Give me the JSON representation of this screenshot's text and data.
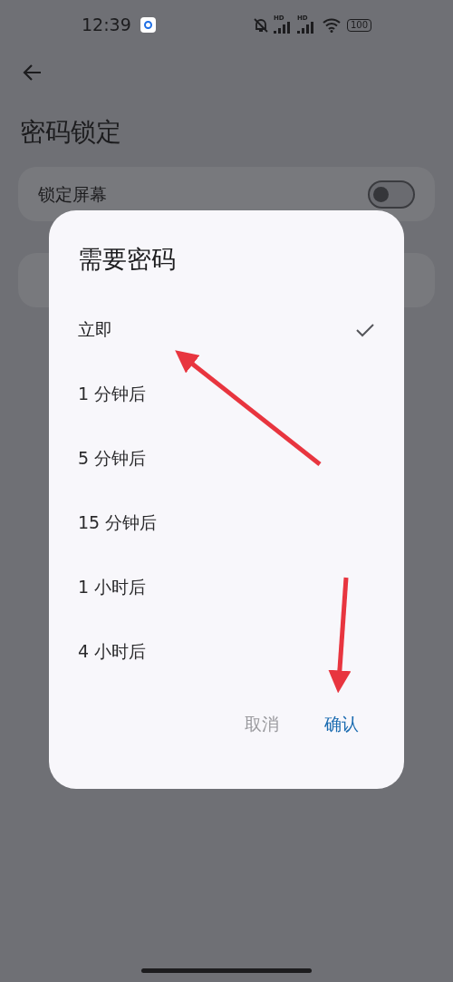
{
  "status_bar": {
    "time": "12:39",
    "signal_labels": [
      "HD",
      "HD"
    ],
    "battery": "100"
  },
  "page": {
    "title": "密码锁定",
    "rows": [
      {
        "kind": "toggle",
        "label": "锁定屏幕",
        "on": false
      },
      {
        "kind": "plain"
      }
    ]
  },
  "dialog": {
    "title": "需要密码",
    "options": [
      {
        "label": "立即",
        "selected": true
      },
      {
        "label": "1 分钟后",
        "selected": false
      },
      {
        "label": "5 分钟后",
        "selected": false
      },
      {
        "label": "15 分钟后",
        "selected": false
      },
      {
        "label": "1 小时后",
        "selected": false
      },
      {
        "label": "4 小时后",
        "selected": false
      }
    ],
    "buttons": [
      {
        "kind": "secondary",
        "label": "取消"
      },
      {
        "kind": "primary",
        "label": "确认"
      }
    ]
  }
}
